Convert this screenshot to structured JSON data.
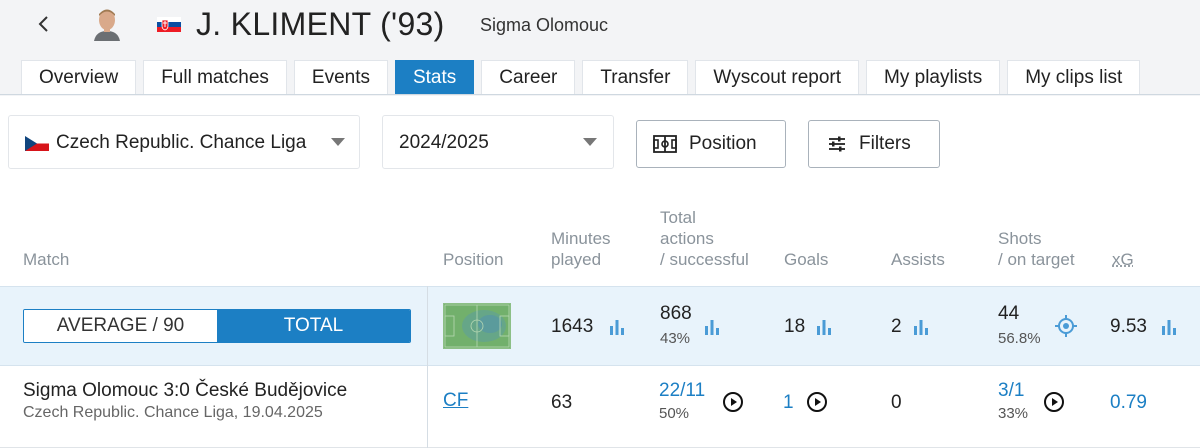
{
  "player": {
    "name": "J. KLIMENT ('93)",
    "club": "Sigma Olomouc"
  },
  "tabs": [
    "Overview",
    "Full matches",
    "Events",
    "Stats",
    "Career",
    "Transfer",
    "Wyscout report",
    "My playlists",
    "My clips list"
  ],
  "active_tab": "Stats",
  "filters": {
    "league": "Czech Republic. Chance Liga",
    "season": "2024/2025",
    "position_button": "Position",
    "filters_button": "Filters"
  },
  "table": {
    "headers": {
      "match": "Match",
      "position": "Position",
      "minutes_l1": "Minutes",
      "minutes_l2": "played",
      "actions_l1": "Total",
      "actions_l2": "actions",
      "actions_l3": "/ successful",
      "goals": "Goals",
      "assists": "Assists",
      "shots_l1": "Shots",
      "shots_l2": "/ on target",
      "xg": "xG"
    },
    "toggle": {
      "average": "AVERAGE / 90",
      "total": "TOTAL",
      "selected": "TOTAL"
    },
    "totals": {
      "minutes": "1643",
      "actions": "868",
      "actions_pct": "43%",
      "goals": "18",
      "assists": "2",
      "shots": "44",
      "shots_pct": "56.8%",
      "xg": "9.53"
    },
    "matches": [
      {
        "title": "Sigma Olomouc 3:0 České Budějovice",
        "subtitle": "Czech Republic. Chance Liga, 19.04.2025",
        "position": "CF",
        "minutes": "63",
        "actions": "22/11",
        "actions_pct": "50%",
        "goals": "1",
        "assists": "0",
        "shots": "3/1",
        "shots_pct": "33%",
        "xg": "0.79"
      }
    ]
  },
  "colors": {
    "accent": "#1c7fc4",
    "row_highlight": "#e8f3fb",
    "header_bg": "#f3f4f6"
  },
  "icons": [
    "back-arrow-icon",
    "player-avatar",
    "slovakia-flag-icon",
    "czech-flag-icon",
    "pitch-icon",
    "sliders-icon",
    "bar-chart-icon",
    "play-icon",
    "target-icon",
    "heatmap-pitch"
  ]
}
